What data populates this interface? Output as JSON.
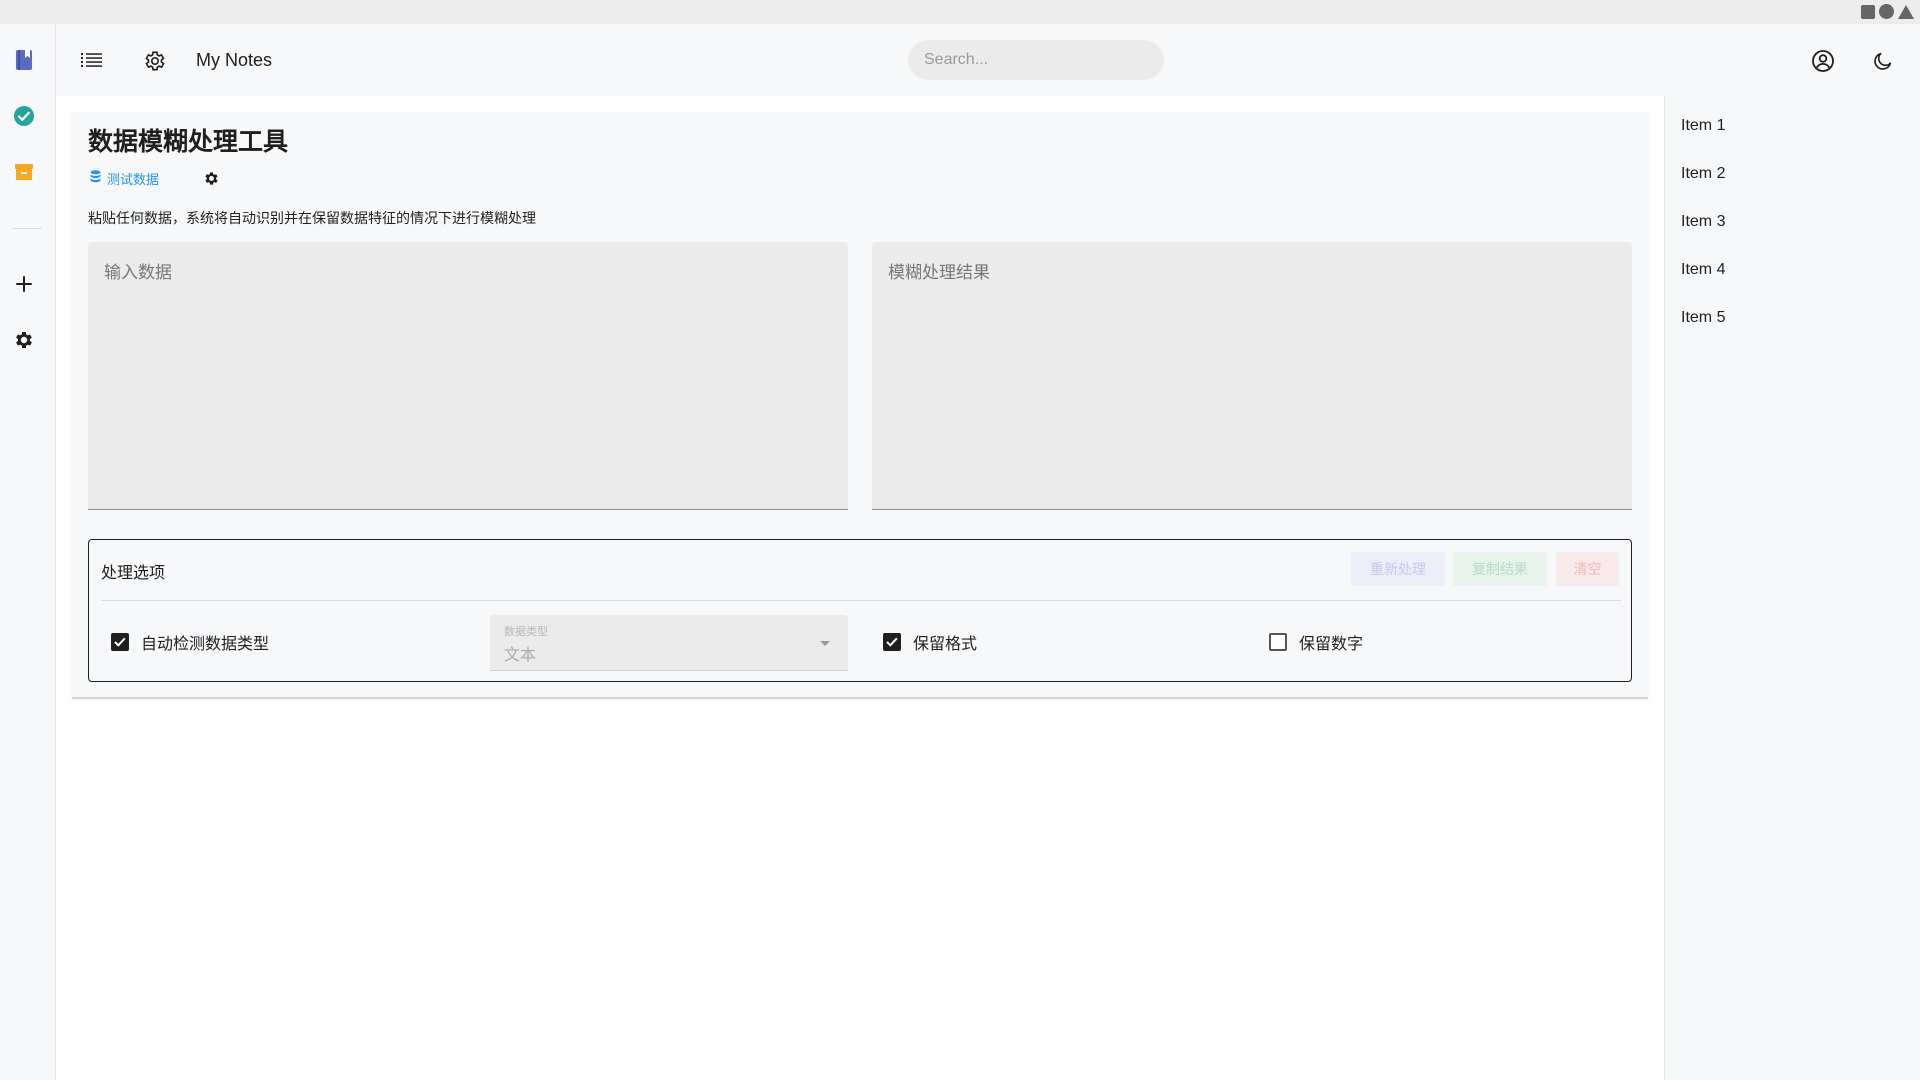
{
  "header": {
    "app_title": "My Notes",
    "search_placeholder": "Search..."
  },
  "rail": {
    "icons": [
      "notebook-icon",
      "check-circle-icon",
      "archive-icon",
      "plus-icon",
      "gear-icon"
    ],
    "colors": {
      "notebook": "#5c6bc0",
      "check": "#26a69a",
      "archive": "#f5a623"
    }
  },
  "page": {
    "title": "数据模糊处理工具",
    "test_data_label": "测试数据",
    "description": "粘贴任何数据，系统将自动识别并在保留数据特征的情况下进行模糊处理",
    "input_placeholder": "输入数据",
    "output_placeholder": "模糊处理结果"
  },
  "options": {
    "title": "处理选项",
    "buttons": {
      "reprocess": "重新处理",
      "copy": "复制结果",
      "clear": "清空"
    },
    "auto_detect": {
      "label": "自动检测数据类型",
      "checked": true
    },
    "data_type": {
      "label": "数据类型",
      "value": "文本",
      "disabled": true
    },
    "keep_format": {
      "label": "保留格式",
      "checked": true
    },
    "keep_numbers": {
      "label": "保留数字",
      "checked": false
    }
  },
  "sidebar_right": {
    "items": [
      {
        "label": "Item 1"
      },
      {
        "label": "Item 2"
      },
      {
        "label": "Item 3"
      },
      {
        "label": "Item 4"
      },
      {
        "label": "Item 5"
      }
    ]
  }
}
